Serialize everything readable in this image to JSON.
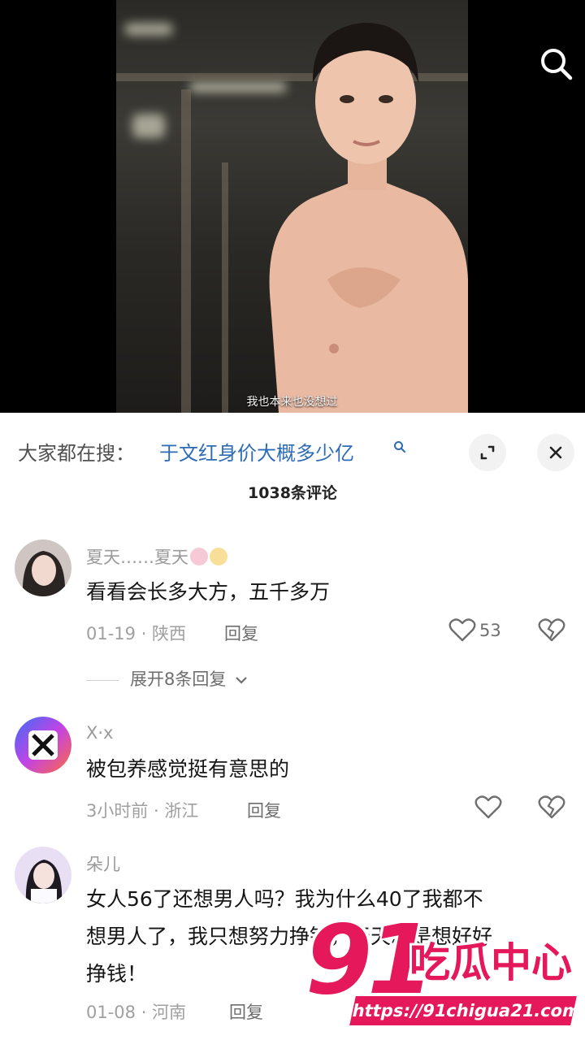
{
  "video": {
    "caption": "我也本来也没想过",
    "search_icon": "search-icon"
  },
  "comments_panel": {
    "search_prefix": "大家都在搜：",
    "search_query": "于文红身价大概多少亿",
    "comment_count": "1038条评论",
    "expand_icon": "expand-icon",
    "close_icon": "close-icon"
  },
  "comments": [
    {
      "name": "夏天……夏天",
      "text": "看看会长多大方，五千多万",
      "meta": "01-19 · 陕西",
      "reply_label": "回复",
      "likes": "53",
      "expand_replies": "展开8条回复"
    },
    {
      "name": "X·x",
      "text": "被包养感觉挺有意思的",
      "meta": "3小时前 · 浙江",
      "reply_label": "回复",
      "likes": ""
    },
    {
      "name": "朵儿",
      "text_line1": "女人56了还想男人吗？我为什么40了我都不",
      "text_line2": "想男人了，我只想努力挣钱，天天就是想好好",
      "text_line3": "挣钱！",
      "meta": "01-08 · 河南",
      "reply_label": "回复"
    }
  ],
  "watermark": {
    "logo_number": "91",
    "logo_title": "吃瓜中心",
    "url": "https://91chigua21.com"
  },
  "colors": {
    "link": "#2d6bb6",
    "watermark": "#e4185a"
  }
}
